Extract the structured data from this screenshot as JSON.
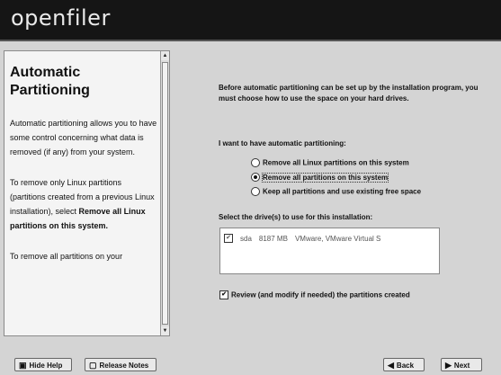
{
  "banner": {
    "logo": "openfiler"
  },
  "help": {
    "title": "Automatic Partitioning",
    "paragraph1": "Automatic partitioning allows you to have some control concerning what data is removed (if any) from your system.",
    "paragraph2_prefix": "To remove only Linux partitions (partitions created from a previous Linux installation), select ",
    "paragraph2_bold": "Remove all Linux partitions on this system.",
    "paragraph3": "To remove all partitions on your"
  },
  "main": {
    "intro": "Before automatic partitioning can be set up by the installation program, you must choose how to use the space on your hard drives.",
    "partition_label": "I want to have automatic partitioning:",
    "options": [
      {
        "label": "Remove all Linux partitions on this system",
        "selected": false
      },
      {
        "label": "Remove all partitions on this system",
        "selected": true
      },
      {
        "label": "Keep all partitions and use existing free space",
        "selected": false
      }
    ],
    "drive_label": "Select the drive(s) to use for this installation:",
    "drives": [
      {
        "checked": true,
        "name": "sda",
        "size": "8187 MB",
        "model": "VMware, VMware Virtual S"
      }
    ],
    "review_label": "Review (and modify if needed) the partitions created",
    "review_checked": true
  },
  "buttons": {
    "hide_help": "Hide Help",
    "release_notes": "Release Notes",
    "back": "Back",
    "next": "Next"
  }
}
